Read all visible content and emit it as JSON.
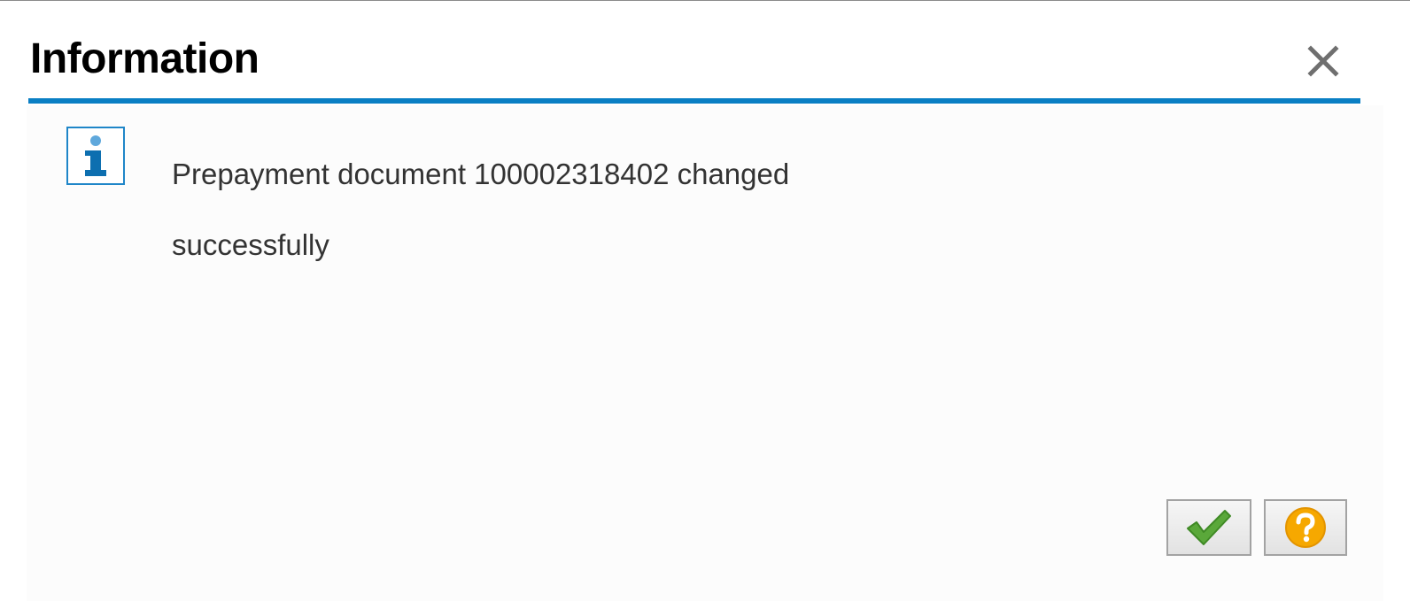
{
  "dialog": {
    "title": "Information",
    "close_icon": "close-icon",
    "message_icon": "info-icon",
    "message_lines": [
      "Prepayment document 100002318402 changed",
      "successfully"
    ],
    "buttons": {
      "ok_icon": "checkmark-icon",
      "help_icon": "help-icon"
    }
  },
  "colors": {
    "accent": "#0a7fc4",
    "check": "#5aa83a",
    "help": "#f6a800"
  }
}
